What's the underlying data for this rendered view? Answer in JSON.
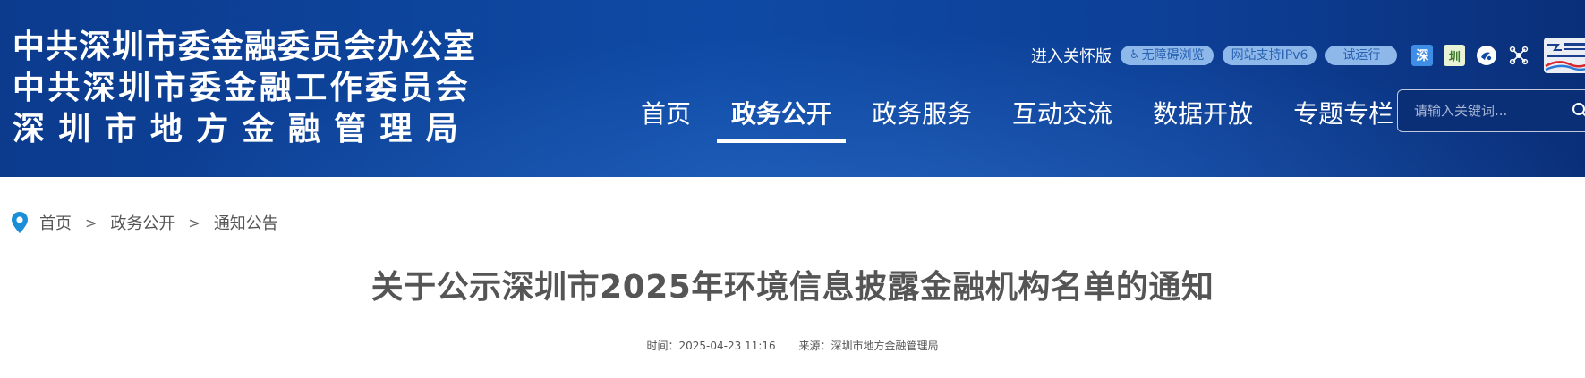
{
  "org": {
    "line1": "中共深圳市委金融委员会办公室",
    "line2": "中共深圳市委金融工作委员会",
    "line3": "深圳市地方金融管理局"
  },
  "toolbar": {
    "care_label": "进入关怀版",
    "accessibility_label": "无障碍浏览",
    "ipv6_label": "网站支持IPv6",
    "trial_label": "试运行",
    "icon_box_1": "深",
    "icon_box_2": "圳"
  },
  "nav": {
    "items": [
      "首页",
      "政务公开",
      "政务服务",
      "互动交流",
      "数据开放",
      "专题专栏"
    ],
    "active_index": 1
  },
  "search": {
    "placeholder": "请输入关键词..."
  },
  "breadcrumb": {
    "items": [
      "首页",
      "政务公开",
      "通知公告"
    ],
    "separator": ">"
  },
  "article": {
    "title": "关于公示深圳市2025年环境信息披露金融机构名单的通知",
    "time_text": "时间：2025-04-23 11:16",
    "source_text": "来源：深圳市地方金融管理局"
  },
  "colors": {
    "header_bg": "#0e4aa5",
    "pill_bg": "#8fb8ea",
    "pin": "#1a8fd8"
  },
  "icons": [
    "wheelchair-icon",
    "shenzhen-app-icon",
    "mini-program-icon",
    "weibo-icon",
    "share-network-icon",
    "shenzhen-china-logo",
    "search-icon",
    "location-pin-icon"
  ]
}
